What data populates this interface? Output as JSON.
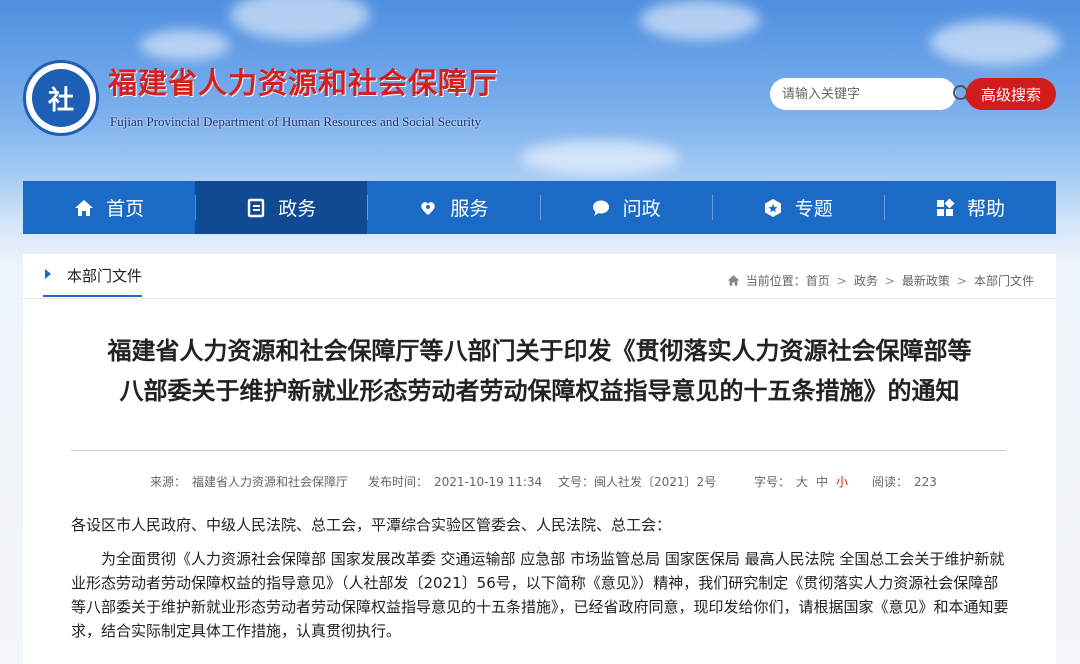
{
  "header": {
    "logo_text": "福建省人力资源和社会保障厅",
    "logo_en": "Fujian Provincial Department of Human Resources and Social Security",
    "logo_badge": "社",
    "search": {
      "placeholder": "请输入关键字"
    },
    "advanced_search_label": "高级搜索"
  },
  "nav": {
    "items": [
      {
        "label": "首页",
        "icon": "home-icon"
      },
      {
        "label": "政务",
        "icon": "document-icon",
        "active": true
      },
      {
        "label": "服务",
        "icon": "service-icon"
      },
      {
        "label": "问政",
        "icon": "chat-icon"
      },
      {
        "label": "专题",
        "icon": "topic-icon"
      },
      {
        "label": "帮助",
        "icon": "grid-icon"
      }
    ]
  },
  "section": {
    "tab_label": "本部门文件",
    "breadcrumb": {
      "prefix": "当前位置：",
      "items": [
        "首页",
        "政务",
        "最新政策",
        "本部门文件"
      ],
      "separator": ">"
    }
  },
  "article": {
    "title_line1": "福建省人力资源和社会保障厅等八部门关于印发《贯彻落实人力资源社会保障部等",
    "title_line2": "八部委关于维护新就业形态劳动者劳动保障权益指导意见的十五条措施》的通知",
    "meta": {
      "source_label": "来源：",
      "source": "福建省人力资源和社会保障厅",
      "date_label": "发布时间：",
      "date": "2021-10-19 11:34",
      "doc_no_label": "文号：",
      "doc_no": "闽人社发〔2021〕2号",
      "font_size_label": "字号：",
      "font_sizes": [
        "大",
        "中",
        "小"
      ],
      "views_label": "阅读：",
      "views": "223"
    },
    "salutation": "各设区市人民政府、中级人民法院、总工会，平潭综合实验区管委会、人民法院、总工会：",
    "paragraph1": "为全面贯彻《人力资源社会保障部 国家发展改革委 交通运输部 应急部 市场监管总局 国家医保局 最高人民法院 全国总工会关于维护新就业形态劳动者劳动保障权益的指导意见》（人社部发〔2021〕56号，以下简称《意见》）精神，我们研究制定《贯彻落实人力资源社会保障部等八部委关于维护新就业形态劳动者劳动保障权益指导意见的十五条措施》，已经省政府同意，现印发给你们，请根据国家《意见》和本通知要求，结合实际制定具体工作措施，认真贯彻执行。"
  },
  "colors": {
    "nav_blue": "#1b6bc6",
    "nav_active": "#0f4a93",
    "accent_red": "#d21c1c",
    "logo_red": "#d81e1e"
  }
}
